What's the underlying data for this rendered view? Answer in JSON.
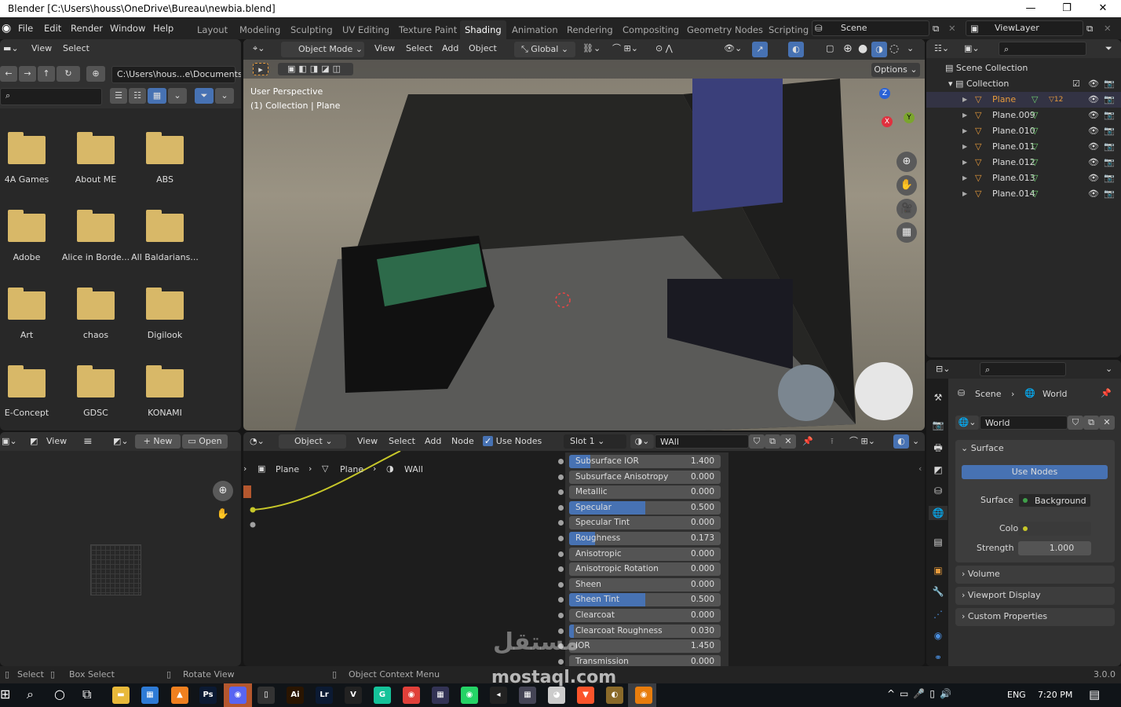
{
  "window": {
    "title": "Blender [C:\\Users\\houss\\OneDrive\\Bureau\\newbia.blend]",
    "minimize": "—",
    "maximize": "❐",
    "close": "✕"
  },
  "menu": [
    "File",
    "Edit",
    "Render",
    "Window",
    "Help"
  ],
  "workspaces": [
    "Layout",
    "Modeling",
    "Sculpting",
    "UV Editing",
    "Texture Paint",
    "Shading",
    "Animation",
    "Rendering",
    "Compositing",
    "Geometry Nodes",
    "Scripting"
  ],
  "active_workspace": "Shading",
  "scene": {
    "label": "Scene",
    "view_layer": "ViewLayer"
  },
  "file_browser": {
    "header": [
      "View",
      "Select"
    ],
    "path": "C:\\Users\\hous...e\\Documents\\",
    "folders": [
      "4A Games",
      "About ME",
      "ABS",
      "Adobe",
      "Alice in Borde...",
      "All Baldarians...",
      "Art",
      "chaos",
      "Digilook",
      "E-Concept",
      "GDSC",
      "KONAMI"
    ]
  },
  "image_editor": {
    "view": "View",
    "new": "New",
    "open": "Open"
  },
  "viewport": {
    "mode": "Object Mode",
    "menus": [
      "View",
      "Select",
      "Add",
      "Object"
    ],
    "transform": "Global",
    "options": "Options",
    "info_line1": "User Perspective",
    "info_line2": "(1) Collection | Plane",
    "gizmo_axes": [
      "Z",
      "Y",
      "X"
    ]
  },
  "outliner": {
    "scene_collection": "Scene Collection",
    "collection": "Collection",
    "items": [
      "Plane",
      "Plane.009",
      "Plane.010",
      "Plane.011",
      "Plane.012",
      "Plane.013",
      "Plane.014"
    ],
    "plane_badge": "12"
  },
  "node_editor": {
    "object": "Object",
    "menus": [
      "View",
      "Select",
      "Add",
      "Node"
    ],
    "use_nodes": "Use Nodes",
    "slot": "Slot 1",
    "material": "WAll",
    "breadcrumb": [
      "Plane",
      "Plane",
      "WAll"
    ],
    "inputs": [
      {
        "label": "Subsurface IOR",
        "value": "1.400",
        "fill": 0.14
      },
      {
        "label": "Subsurface Anisotropy",
        "value": "0.000",
        "fill": 0
      },
      {
        "label": "Metallic",
        "value": "0.000",
        "fill": 0
      },
      {
        "label": "Specular",
        "value": "0.500",
        "fill": 0.5
      },
      {
        "label": "Specular Tint",
        "value": "0.000",
        "fill": 0
      },
      {
        "label": "Roughness",
        "value": "0.173",
        "fill": 0.173
      },
      {
        "label": "Anisotropic",
        "value": "0.000",
        "fill": 0
      },
      {
        "label": "Anisotropic Rotation",
        "value": "0.000",
        "fill": 0
      },
      {
        "label": "Sheen",
        "value": "0.000",
        "fill": 0
      },
      {
        "label": "Sheen Tint",
        "value": "0.500",
        "fill": 0.5
      },
      {
        "label": "Clearcoat",
        "value": "0.000",
        "fill": 0
      },
      {
        "label": "Clearcoat Roughness",
        "value": "0.030",
        "fill": 0.03
      },
      {
        "label": "IOR",
        "value": "1.450",
        "fill": 0
      },
      {
        "label": "Transmission",
        "value": "0.000",
        "fill": 0
      }
    ]
  },
  "properties": {
    "breadcrumb": [
      "Scene",
      "World"
    ],
    "world": "World",
    "surface_section": "Surface",
    "use_nodes": "Use Nodes",
    "surface_label": "Surface",
    "surface_value": "Background",
    "color_label": "Color",
    "strength_label": "Strength",
    "strength_value": "1.000",
    "sections": [
      "Volume",
      "Viewport Display",
      "Custom Properties"
    ]
  },
  "statusbar": {
    "select": "Select",
    "box_select": "Box Select",
    "rotate_view": "Rotate View",
    "context_menu": "Object Context Menu",
    "version": "3.0.0"
  },
  "watermark": "mostaql.com",
  "taskbar": {
    "lang": "ENG",
    "time": "7:20 PM"
  },
  "colors": {
    "accent": "#4772b3",
    "folder": "#d8b868",
    "active_object": "#e89b3c"
  }
}
